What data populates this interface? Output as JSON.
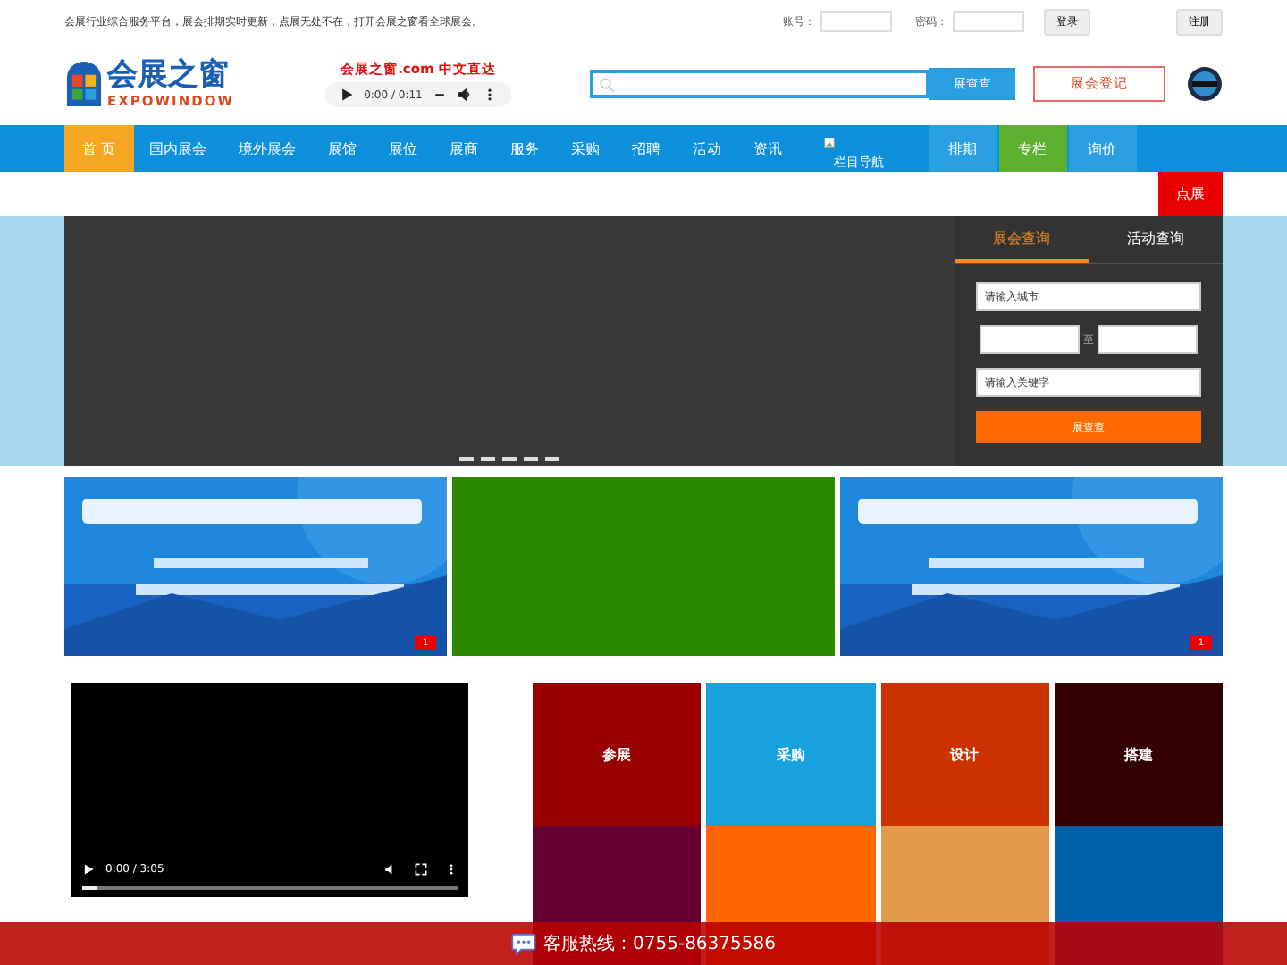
{
  "top_bar": {
    "tagline": "会展行业综合服务平台，展会排期实时更新，点展无处不在，打开会展之窗看全球展会。",
    "account_label": "账号：",
    "password_label": "密码：",
    "login_button": "登录",
    "register_button": "注册"
  },
  "header": {
    "logo_cn": "会展之窗",
    "logo_en": "EXPOWINDOW",
    "slogan": "会展之窗.com 中文直达",
    "audio_time": "0:00 / 0:11",
    "search_button": "展查查",
    "register_button": "展会登记"
  },
  "nav": {
    "items": [
      {
        "label": "首 页",
        "selected": true
      },
      {
        "label": "国内展会",
        "selected": false
      },
      {
        "label": "境外展会",
        "selected": false
      },
      {
        "label": "展馆",
        "selected": false
      },
      {
        "label": "展位",
        "selected": false
      },
      {
        "label": "展商",
        "selected": false
      },
      {
        "label": "服务",
        "selected": false
      },
      {
        "label": "采购",
        "selected": false
      },
      {
        "label": "招聘",
        "selected": false
      },
      {
        "label": "活动",
        "selected": false
      },
      {
        "label": "资讯",
        "selected": false
      }
    ],
    "image_alt": "栏目导航",
    "right_items": [
      {
        "label": "排期",
        "color": "#2aa0e2"
      },
      {
        "label": "专栏",
        "color": "#5db12f"
      },
      {
        "label": "询价",
        "color": "#2aa0e2"
      }
    ],
    "extra_item": "点展"
  },
  "slider": {
    "tabs": [
      {
        "label": "展会查询",
        "selected": true
      },
      {
        "label": "活动查询",
        "selected": false
      }
    ],
    "city_placeholder": "请输入城市",
    "separator": "至",
    "keyword_placeholder": "请输入关键字",
    "search_button": "展查查"
  },
  "banners": [
    {
      "kind": "picture",
      "badge": "1"
    },
    {
      "kind": "plain"
    },
    {
      "kind": "picture",
      "badge": "1"
    }
  ],
  "video": {
    "time": "0:00 / 3:05",
    "level": 0.04
  },
  "tiles": [
    {
      "label": "参展",
      "color": "#990000"
    },
    {
      "label": "采购",
      "color": "#17a2de"
    },
    {
      "label": "设计",
      "color": "#cc3300"
    },
    {
      "label": "搭建",
      "color": "#330000"
    },
    {
      "color": "#660033"
    },
    {
      "color": "#ff6600"
    },
    {
      "color": "#e09a4a"
    },
    {
      "color": "#0060a8"
    }
  ],
  "hotline": "客服热线：0755-86375586"
}
